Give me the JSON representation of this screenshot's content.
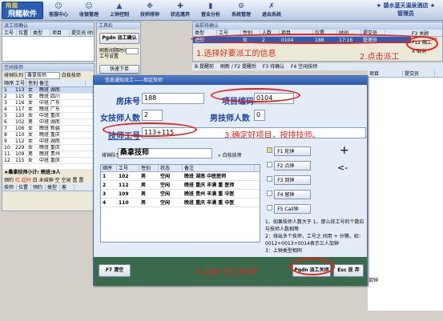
{
  "app": {
    "logo": "飛龍軟件",
    "logo_top": "飛龍",
    "hotel": "★ 碧水蓝天温泉酒店 ★",
    "user": "管理员"
  },
  "toolbar": [
    "客服中心",
    "收银管理",
    "上钟控制",
    "技师排钟",
    "状态遗弃",
    "营业分析",
    "系统管理",
    "退出系统"
  ],
  "left": {
    "title": "派工待确认",
    "cols": [
      "工号",
      "位置",
      "类型",
      "项目",
      "提交员",
      "时间"
    ],
    "tech_title": "空闲技师",
    "sort_label": "排钟队列",
    "sort_value": "桑拿技师",
    "white_tech": "白枝技师",
    "tech_cols": [
      "顺序",
      "工号",
      "性别",
      "备注"
    ],
    "techs": [
      [
        "1",
        "113",
        "女",
        "晚班 湖南"
      ],
      [
        "2",
        "115",
        "女",
        "晚班 四川"
      ],
      [
        "3",
        "116",
        "女",
        "中班 广东"
      ],
      [
        "4",
        "117",
        "女",
        "晚班 广东"
      ],
      [
        "5",
        "120",
        "女",
        "中班 重庆"
      ],
      [
        "6",
        "102",
        "男",
        "中班 湖南"
      ],
      [
        "7",
        "106",
        "女",
        "晚班 新疆"
      ],
      [
        "8",
        "110",
        "女",
        "晚班 重庆"
      ],
      [
        "9",
        "112",
        "女",
        "中班 湖南"
      ],
      [
        "10",
        "229",
        "女",
        "晚班 重庆"
      ],
      [
        "11",
        "109",
        "男",
        "晚班 贵州"
      ],
      [
        "12",
        "115",
        "女",
        "中班 重庆"
      ]
    ],
    "summary": "★桑拿技师小计: 晚班:9人",
    "tabs": [
      "预约",
      "红 超时",
      "白 未结钟",
      "空 空闲",
      "置 置"
    ],
    "bottom_cols": [
      "技师",
      "位置",
      "预约",
      "类型",
      "客"
    ]
  },
  "middle": {
    "title": "工具栏",
    "btn1": "Pgdn 派工确认",
    "label": "刷新间隔时间",
    "label2": "工号设置",
    "btn2": "快速下单"
  },
  "top": {
    "title": "当前待确认",
    "cols": [
      "类型",
      "工号",
      "性别",
      "人数",
      "项目",
      "位置",
      "时间",
      "提交员"
    ],
    "row": [
      "通知",
      "",
      "女",
      "2",
      "0104",
      "188",
      "17:16",
      "管理员"
    ],
    "side": [
      "F3 关顾",
      "F12 确工",
      "X 取消"
    ]
  },
  "tabs2": [
    "B 提醒前",
    "刷新 / F2 提醒后",
    "F3 待确认",
    "F4 空闲技师"
  ],
  "right_cols": [
    "项目",
    "提交员"
  ],
  "dialog": {
    "title": "信息通知派工——指定技师",
    "room_label": "房床号",
    "room": "188",
    "proj_label": "项目编码",
    "proj": "0104",
    "female_label": "女技师人数",
    "female": "2",
    "male_label": "男技师人数",
    "male": "0",
    "tech_label": "技师工号",
    "tech": "113+115",
    "sort_label": "排钟队列",
    "sort_value": "桑拿技师",
    "white": "白枝技师",
    "cols": [
      "顺序",
      "工号",
      "性别",
      "状态",
      "备注"
    ],
    "rows": [
      [
        "1",
        "102",
        "男",
        "空闲",
        "晚班 湖南 中医医师"
      ],
      [
        "2",
        "112",
        "男",
        "空闲",
        "晚班 重庆 丰满 重 医师"
      ],
      [
        "3",
        "109",
        "男",
        "空闲",
        "晚班 贵州 丰满 重 中医"
      ],
      [
        "4",
        "110",
        "男",
        "空闲",
        "晚班 重庆 丰满 重 中医"
      ]
    ],
    "fbtns": [
      "F1 轮钟",
      "F2 点钟",
      "F3 到钟",
      "F4 留钟",
      "F5 Call钟"
    ],
    "notes": [
      "1、如果技师人数大于 1，那么技工号的个数应与技师人数相等",
      "2：排出多个技师，工号之 间用 + 分隔，如：0012+0013+0014表示三人加钟",
      "3：上钟类型相同"
    ],
    "btn_clear": "F7 清空",
    "btn_close": "Pgdn 派工关闭",
    "btn_esc": "Esc 放 弃"
  },
  "ann": {
    "a1": "1.选择好要派工的信息",
    "a2": "2.点击派工",
    "a3": "3.确定好项目，按排技师。",
    "a4": "4.点击“派工关闭”",
    "plus": "+",
    "arrow": "<-"
  },
  "status": {
    "a": "客服",
    "b": "部钟"
  }
}
